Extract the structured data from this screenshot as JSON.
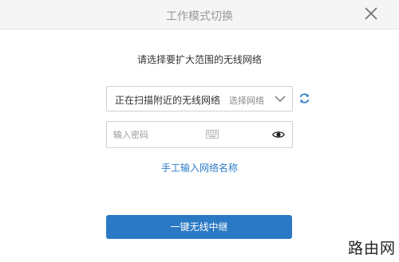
{
  "dialog": {
    "title": "工作模式切换",
    "subtitle": "请选择要扩大范围的无线网络"
  },
  "network_select": {
    "current": "正在扫描附近的无线网络",
    "placeholder": "选择网络"
  },
  "password": {
    "placeholder": "输入密码"
  },
  "manual_link": "手工输入网络名称",
  "primary_button": "一键无线中继",
  "watermark": "路由网",
  "icons": {
    "close": "close-icon",
    "chevron": "chevron-down-icon",
    "refresh": "refresh-icon",
    "keyboard": "keyboard-icon",
    "eye": "eye-icon"
  },
  "colors": {
    "accent": "#2b79c4",
    "link": "#2e7cc7",
    "header_bg": "#f5f5f5"
  }
}
